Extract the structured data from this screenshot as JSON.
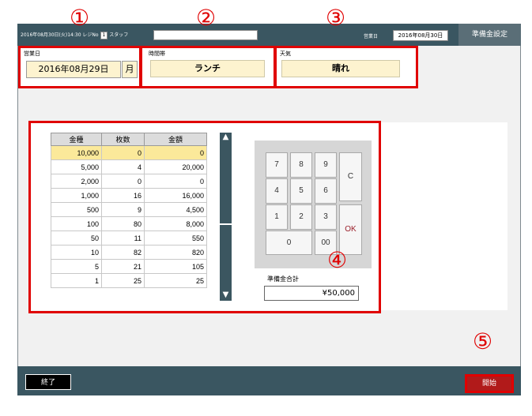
{
  "topbar": {
    "info_text": "2016年08月30日(火)14:30 レジNo",
    "register_no": "1",
    "staff_label": "スタッフ",
    "business_date_label": "営業日",
    "business_date": "2016年08月30日",
    "title": "準備金設定"
  },
  "fields": {
    "business_day_label": "営業日",
    "business_day_value": "2016年08月29日",
    "day_of_week": "月",
    "time_slot_label": "時間帯",
    "time_slot_value": "ランチ",
    "weather_label": "天気",
    "weather_value": "晴れ"
  },
  "table": {
    "headers": [
      "金種",
      "枚数",
      "金額"
    ],
    "rows": [
      [
        "10,000",
        "0",
        "0"
      ],
      [
        "5,000",
        "4",
        "20,000"
      ],
      [
        "2,000",
        "0",
        "0"
      ],
      [
        "1,000",
        "16",
        "16,000"
      ],
      [
        "500",
        "9",
        "4,500"
      ],
      [
        "100",
        "80",
        "8,000"
      ],
      [
        "50",
        "11",
        "550"
      ],
      [
        "10",
        "82",
        "820"
      ],
      [
        "5",
        "21",
        "105"
      ],
      [
        "1",
        "25",
        "25"
      ]
    ]
  },
  "keypad": {
    "k7": "7",
    "k8": "8",
    "k9": "9",
    "k4": "4",
    "k5": "5",
    "k6": "6",
    "k1": "1",
    "k2": "2",
    "k3": "3",
    "k0": "0",
    "k00": "00",
    "clear": "C",
    "ok": "OK"
  },
  "total": {
    "label": "準備金合計",
    "value": "¥50,000"
  },
  "buttons": {
    "end": "終了",
    "start": "開始"
  },
  "callouts": [
    "①",
    "②",
    "③",
    "④",
    "⑤"
  ],
  "colors": {
    "annotation_red": "#e00000",
    "header_bar": "#3a5661",
    "highlight": "#fbe99a"
  }
}
